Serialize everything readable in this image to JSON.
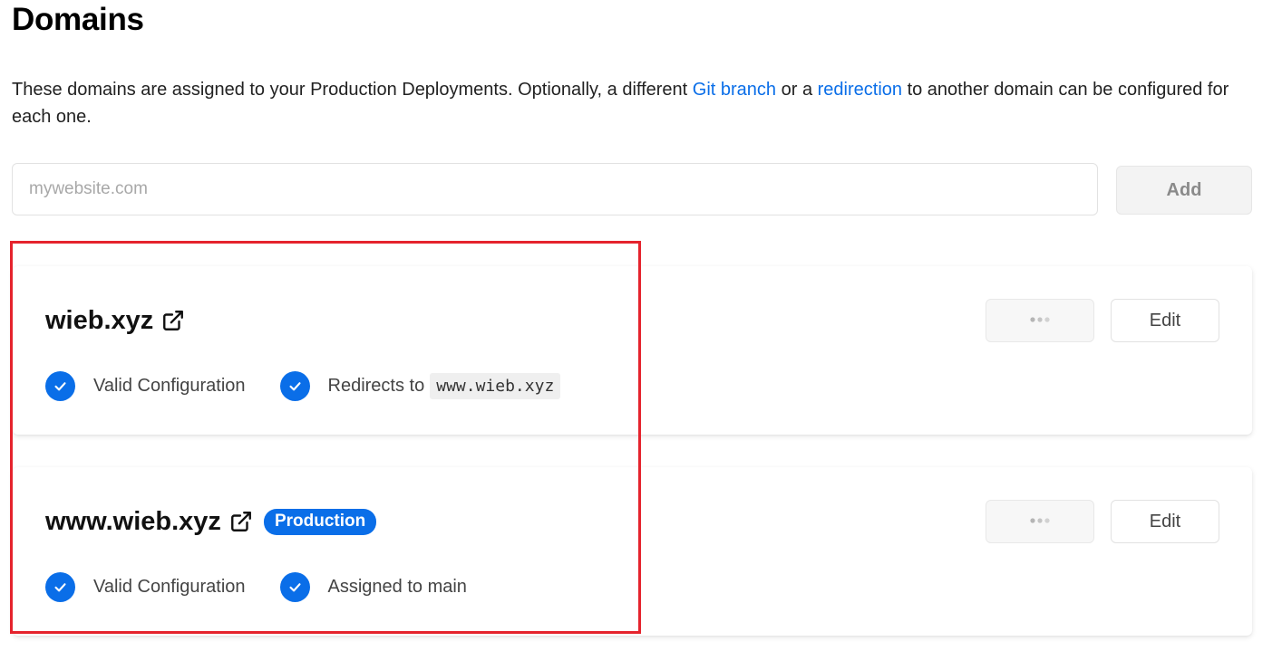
{
  "header": {
    "title": "Domains"
  },
  "description": {
    "text_before": "These domains are assigned to your Production Deployments. Optionally, a different ",
    "git_branch_link": "Git branch",
    "text_middle": " or a ",
    "redirection_link": "redirection",
    "text_after": " to another domain can be configured for each one."
  },
  "add_domain": {
    "placeholder": "mywebsite.com",
    "value": "",
    "add_label": "Add"
  },
  "domains": [
    {
      "name": "wieb.xyz",
      "badge": "",
      "status": [
        {
          "label": "Valid Configuration",
          "code": ""
        },
        {
          "label": "Redirects to",
          "code": "www.wieb.xyz"
        }
      ],
      "more_label": "•••",
      "edit_label": "Edit"
    },
    {
      "name": "www.wieb.xyz",
      "badge": "Production",
      "status": [
        {
          "label": "Valid Configuration",
          "code": ""
        },
        {
          "label": "Assigned to main",
          "code": ""
        }
      ],
      "more_label": "•••",
      "edit_label": "Edit"
    }
  ],
  "icons": {
    "external_link": "external-link-icon",
    "check": "check-circle-icon",
    "more": "more-horizontal-icon"
  },
  "colors": {
    "accent": "#0a6ee8",
    "highlight": "#e5232d",
    "text": "#111111",
    "muted": "#444444"
  }
}
